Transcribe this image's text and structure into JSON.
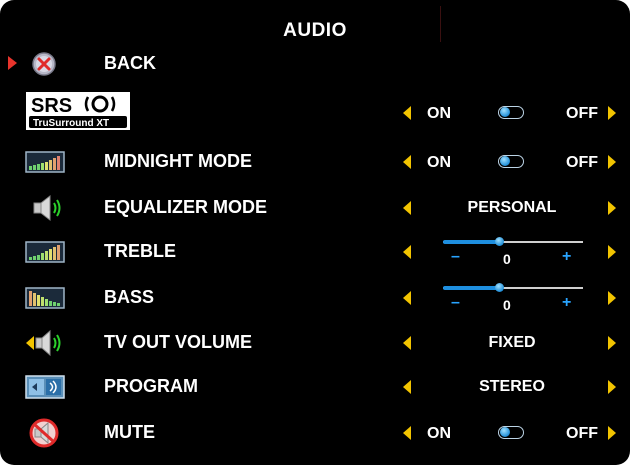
{
  "menu": {
    "title": "AUDIO",
    "items": [
      {
        "label": "BACK",
        "icon": "back-x-icon",
        "selected": true
      },
      {
        "label": "",
        "logo_text": "SRS",
        "logo_subtext": "TruSurround XT",
        "control": {
          "type": "toggle",
          "on": "ON",
          "off": "OFF",
          "state": "on"
        }
      },
      {
        "label": "MIDNIGHT MODE",
        "icon": "midnight-mode-icon",
        "control": {
          "type": "toggle",
          "on": "ON",
          "off": "OFF",
          "state": "on"
        }
      },
      {
        "label": "EQUALIZER MODE",
        "icon": "speaker-icon",
        "control": {
          "type": "select",
          "value": "PERSONAL"
        }
      },
      {
        "label": "TREBLE",
        "icon": "treble-bars-icon",
        "control": {
          "type": "slider",
          "value": "0",
          "minus": "–",
          "plus": "+",
          "level": 0.4
        }
      },
      {
        "label": "BASS",
        "icon": "bass-bars-icon",
        "control": {
          "type": "slider",
          "value": "0",
          "minus": "–",
          "plus": "+",
          "level": 0.4
        }
      },
      {
        "label": "TV OUT VOLUME",
        "icon": "tv-out-volume-icon",
        "control": {
          "type": "select",
          "value": "FIXED"
        }
      },
      {
        "label": "PROGRAM",
        "icon": "program-icon",
        "control": {
          "type": "select",
          "value": "STEREO"
        }
      },
      {
        "label": "MUTE",
        "icon": "mute-icon",
        "control": {
          "type": "toggle",
          "on": "ON",
          "off": "OFF",
          "state": "on"
        }
      }
    ]
  },
  "colors": {
    "background": "#000000",
    "arrow": "#f2c400",
    "pointer": "#e8342c",
    "accent": "#1e8fe0"
  }
}
